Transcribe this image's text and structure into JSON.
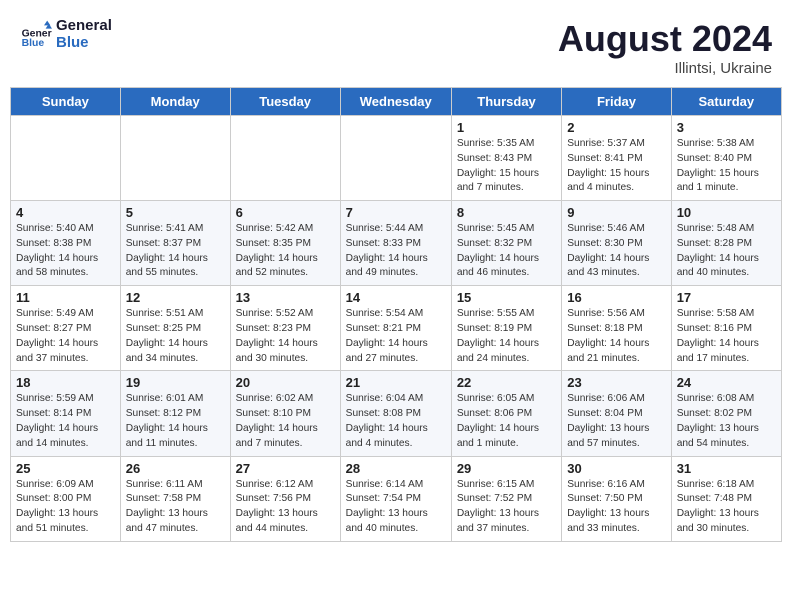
{
  "logo": {
    "line1": "General",
    "line2": "Blue"
  },
  "title": "August 2024",
  "subtitle": "Illintsi, Ukraine",
  "weekdays": [
    "Sunday",
    "Monday",
    "Tuesday",
    "Wednesday",
    "Thursday",
    "Friday",
    "Saturday"
  ],
  "weeks": [
    [
      {
        "day": "",
        "content": ""
      },
      {
        "day": "",
        "content": ""
      },
      {
        "day": "",
        "content": ""
      },
      {
        "day": "",
        "content": ""
      },
      {
        "day": "1",
        "content": "Sunrise: 5:35 AM\nSunset: 8:43 PM\nDaylight: 15 hours\nand 7 minutes."
      },
      {
        "day": "2",
        "content": "Sunrise: 5:37 AM\nSunset: 8:41 PM\nDaylight: 15 hours\nand 4 minutes."
      },
      {
        "day": "3",
        "content": "Sunrise: 5:38 AM\nSunset: 8:40 PM\nDaylight: 15 hours\nand 1 minute."
      }
    ],
    [
      {
        "day": "4",
        "content": "Sunrise: 5:40 AM\nSunset: 8:38 PM\nDaylight: 14 hours\nand 58 minutes."
      },
      {
        "day": "5",
        "content": "Sunrise: 5:41 AM\nSunset: 8:37 PM\nDaylight: 14 hours\nand 55 minutes."
      },
      {
        "day": "6",
        "content": "Sunrise: 5:42 AM\nSunset: 8:35 PM\nDaylight: 14 hours\nand 52 minutes."
      },
      {
        "day": "7",
        "content": "Sunrise: 5:44 AM\nSunset: 8:33 PM\nDaylight: 14 hours\nand 49 minutes."
      },
      {
        "day": "8",
        "content": "Sunrise: 5:45 AM\nSunset: 8:32 PM\nDaylight: 14 hours\nand 46 minutes."
      },
      {
        "day": "9",
        "content": "Sunrise: 5:46 AM\nSunset: 8:30 PM\nDaylight: 14 hours\nand 43 minutes."
      },
      {
        "day": "10",
        "content": "Sunrise: 5:48 AM\nSunset: 8:28 PM\nDaylight: 14 hours\nand 40 minutes."
      }
    ],
    [
      {
        "day": "11",
        "content": "Sunrise: 5:49 AM\nSunset: 8:27 PM\nDaylight: 14 hours\nand 37 minutes."
      },
      {
        "day": "12",
        "content": "Sunrise: 5:51 AM\nSunset: 8:25 PM\nDaylight: 14 hours\nand 34 minutes."
      },
      {
        "day": "13",
        "content": "Sunrise: 5:52 AM\nSunset: 8:23 PM\nDaylight: 14 hours\nand 30 minutes."
      },
      {
        "day": "14",
        "content": "Sunrise: 5:54 AM\nSunset: 8:21 PM\nDaylight: 14 hours\nand 27 minutes."
      },
      {
        "day": "15",
        "content": "Sunrise: 5:55 AM\nSunset: 8:19 PM\nDaylight: 14 hours\nand 24 minutes."
      },
      {
        "day": "16",
        "content": "Sunrise: 5:56 AM\nSunset: 8:18 PM\nDaylight: 14 hours\nand 21 minutes."
      },
      {
        "day": "17",
        "content": "Sunrise: 5:58 AM\nSunset: 8:16 PM\nDaylight: 14 hours\nand 17 minutes."
      }
    ],
    [
      {
        "day": "18",
        "content": "Sunrise: 5:59 AM\nSunset: 8:14 PM\nDaylight: 14 hours\nand 14 minutes."
      },
      {
        "day": "19",
        "content": "Sunrise: 6:01 AM\nSunset: 8:12 PM\nDaylight: 14 hours\nand 11 minutes."
      },
      {
        "day": "20",
        "content": "Sunrise: 6:02 AM\nSunset: 8:10 PM\nDaylight: 14 hours\nand 7 minutes."
      },
      {
        "day": "21",
        "content": "Sunrise: 6:04 AM\nSunset: 8:08 PM\nDaylight: 14 hours\nand 4 minutes."
      },
      {
        "day": "22",
        "content": "Sunrise: 6:05 AM\nSunset: 8:06 PM\nDaylight: 14 hours\nand 1 minute."
      },
      {
        "day": "23",
        "content": "Sunrise: 6:06 AM\nSunset: 8:04 PM\nDaylight: 13 hours\nand 57 minutes."
      },
      {
        "day": "24",
        "content": "Sunrise: 6:08 AM\nSunset: 8:02 PM\nDaylight: 13 hours\nand 54 minutes."
      }
    ],
    [
      {
        "day": "25",
        "content": "Sunrise: 6:09 AM\nSunset: 8:00 PM\nDaylight: 13 hours\nand 51 minutes."
      },
      {
        "day": "26",
        "content": "Sunrise: 6:11 AM\nSunset: 7:58 PM\nDaylight: 13 hours\nand 47 minutes."
      },
      {
        "day": "27",
        "content": "Sunrise: 6:12 AM\nSunset: 7:56 PM\nDaylight: 13 hours\nand 44 minutes."
      },
      {
        "day": "28",
        "content": "Sunrise: 6:14 AM\nSunset: 7:54 PM\nDaylight: 13 hours\nand 40 minutes."
      },
      {
        "day": "29",
        "content": "Sunrise: 6:15 AM\nSunset: 7:52 PM\nDaylight: 13 hours\nand 37 minutes."
      },
      {
        "day": "30",
        "content": "Sunrise: 6:16 AM\nSunset: 7:50 PM\nDaylight: 13 hours\nand 33 minutes."
      },
      {
        "day": "31",
        "content": "Sunrise: 6:18 AM\nSunset: 7:48 PM\nDaylight: 13 hours\nand 30 minutes."
      }
    ]
  ]
}
